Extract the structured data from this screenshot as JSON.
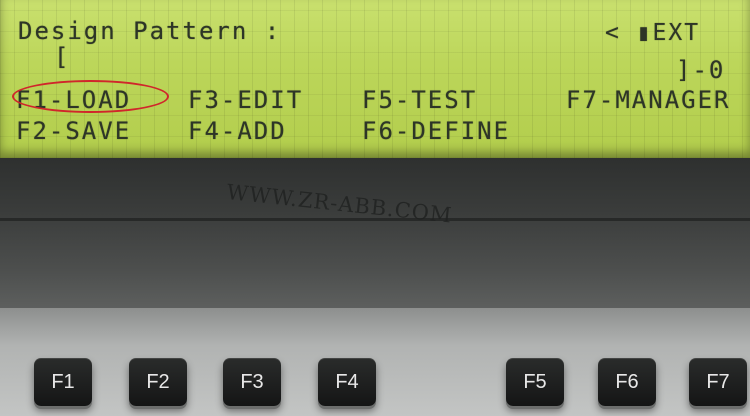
{
  "lcd": {
    "title": "Design Pattern :",
    "ext_indicator": "< ▮EXT",
    "bracket_open": "[",
    "bracket_close": "]-0",
    "functions": {
      "f1": "F1-LOAD",
      "f2": "F2-SAVE",
      "f3": "F3-EDIT",
      "f4": "F4-ADD",
      "f5": "F5-TEST",
      "f6": "F6-DEFINE",
      "f7": "F7-MANAGER"
    },
    "highlight_color": "#d0262b",
    "lcd_background": "#bcd65a"
  },
  "watermark": "WWW.ZR-ABB.COM",
  "keypad": {
    "keys": [
      "F1",
      "F2",
      "F3",
      "F4",
      "F5",
      "F6",
      "F7"
    ]
  }
}
